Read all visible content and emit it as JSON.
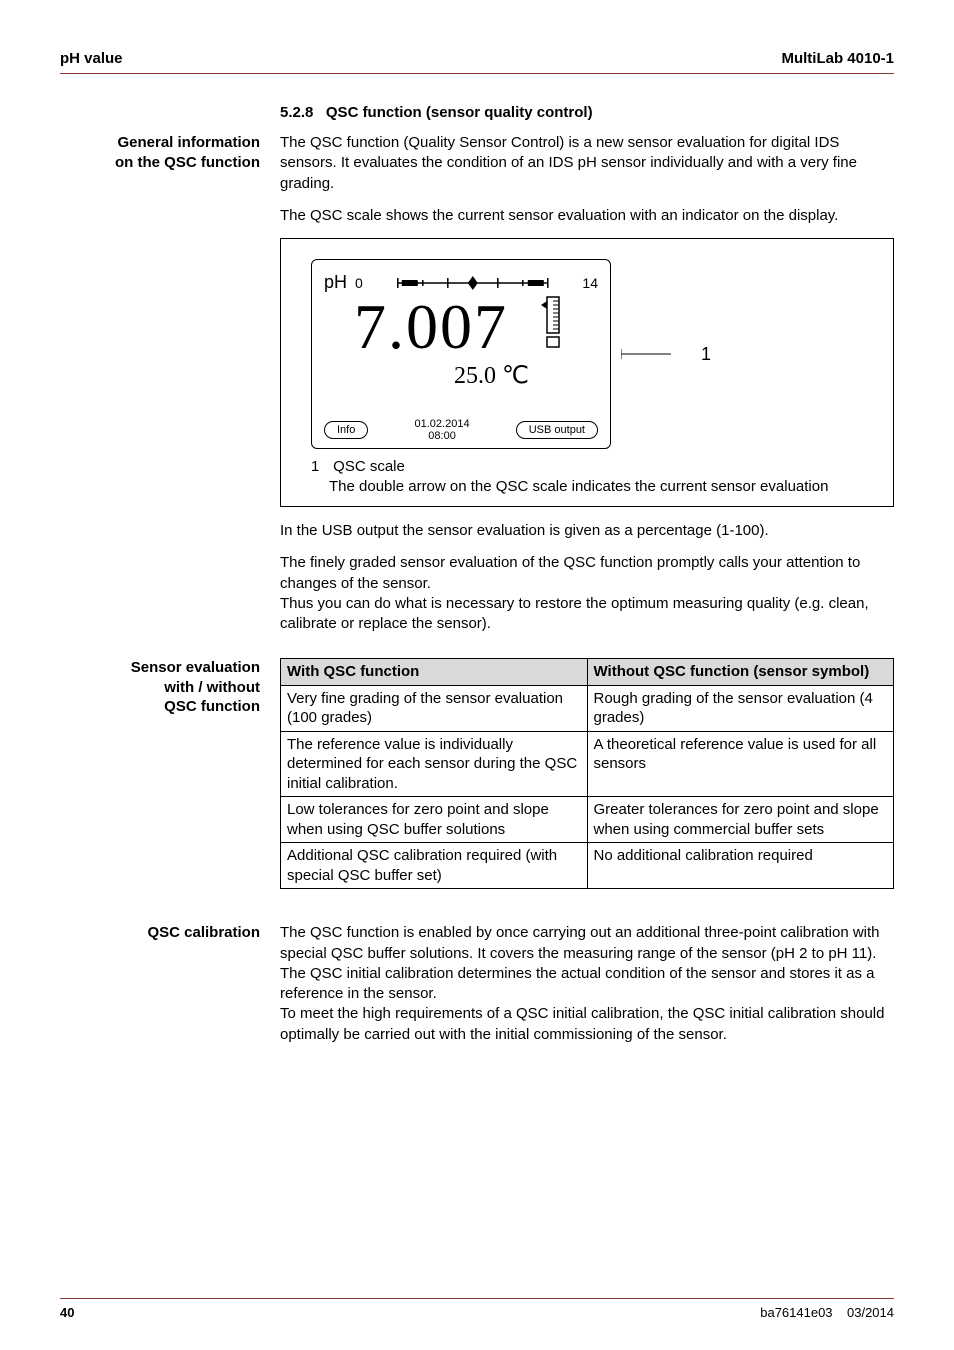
{
  "header": {
    "left": "pH value",
    "right": "MultiLab 4010-1"
  },
  "section": {
    "number": "5.2.8",
    "title": "QSC function (sensor quality control)"
  },
  "blocks": {
    "general_info": {
      "label_l1": "General information",
      "label_l2": "on the QSC function",
      "p1": "The QSC function (Quality Sensor Control) is a new sensor evaluation for digital IDS sensors. It evaluates the condition of an IDS pH sensor individually and with a very fine grading.",
      "p2": "The QSC scale shows the current sensor evaluation with an indicator on the display."
    },
    "lcd": {
      "ph_label": "pH",
      "scale_min": "0",
      "scale_max": "14",
      "reading": "7.007",
      "temperature": "25.0 ℃",
      "softkey_left": "Info",
      "date": "01.02.2014",
      "time": "08:00",
      "softkey_right": "USB output",
      "callout_number": "1"
    },
    "fig_caption": {
      "num": "1",
      "title": "QSC scale",
      "desc": "The double arrow on the QSC scale indicates the current sensor evaluation"
    },
    "after_fig": {
      "p1": "In the USB output the sensor evaluation is given as a percentage (1-100).",
      "p2": "The finely graded sensor evaluation of the QSC function promptly calls your attention to changes of the sensor.",
      "p3": "Thus you can do what is necessary to restore the optimum measuring quality (e.g. clean, calibrate or replace the sensor)."
    },
    "table_section": {
      "label_l1": "Sensor evaluation",
      "label_l2": "with / without",
      "label_l3": "QSC function",
      "header_with": "With QSC function",
      "header_without": "Without QSC function (sensor symbol)",
      "rows": [
        {
          "with": "Very fine grading of the sensor evaluation (100 grades)",
          "without": "Rough grading of the sensor evaluation (4 grades)"
        },
        {
          "with": "The reference value is individually determined for each sensor during the QSC initial calibration.",
          "without": "A theoretical reference value is used for all sensors"
        },
        {
          "with": "Low tolerances for zero point and slope when using QSC buffer solutions",
          "without": "Greater tolerances for zero point and slope when using commercial buffer sets"
        },
        {
          "with": "Additional QSC calibration required (with special QSC buffer set)",
          "without": "No additional calibration required"
        }
      ]
    },
    "qsc_calibration": {
      "label": "QSC calibration",
      "p1": "The QSC function is enabled by once carrying out an additional three-point calibration with special QSC buffer solutions. It covers the measuring range of the sensor (pH 2 to pH 11). The QSC initial calibration determines the actual condition of the sensor and stores it as a reference in the sensor.",
      "p2": "To meet the high requirements of a QSC initial calibration, the QSC initial calibration should optimally be carried out with the initial commissioning of the sensor."
    }
  },
  "footer": {
    "page": "40",
    "doc": "ba76141e03",
    "date": "03/2014"
  }
}
